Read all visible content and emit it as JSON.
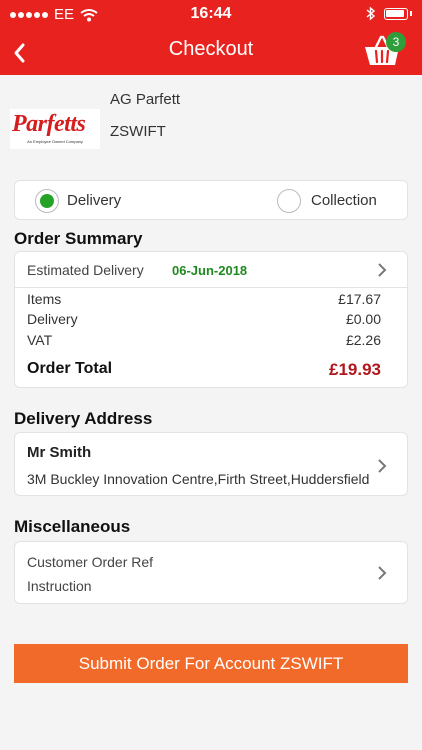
{
  "status_bar": {
    "carrier": "EE",
    "time": "16:44"
  },
  "nav": {
    "title": "Checkout",
    "basket_count": "3",
    "accent_color": "#e8231f"
  },
  "account": {
    "logo_text": "Parfetts",
    "logo_tagline": "An Employee Owned Company",
    "name": "AG Parfett",
    "code": "ZSWIFT"
  },
  "fulfilment": {
    "options": [
      {
        "label": "Delivery",
        "selected": true
      },
      {
        "label": "Collection",
        "selected": false
      }
    ]
  },
  "order_summary": {
    "title": "Order Summary",
    "estimated_label": "Estimated Delivery",
    "estimated_date": "06-Jun-2018",
    "lines": [
      {
        "label": "Items",
        "value": "£17.67"
      },
      {
        "label": "Delivery",
        "value": "£0.00"
      },
      {
        "label": "VAT",
        "value": "£2.26"
      }
    ],
    "total_label": "Order Total",
    "total_value": "£19.93"
  },
  "delivery_address": {
    "title": "Delivery Address",
    "name": "Mr Smith",
    "address": "3M Buckley Innovation Centre,Firth Street,Huddersfield"
  },
  "miscellaneous": {
    "title": "Miscellaneous",
    "ref_label": "Customer Order Ref",
    "instruction_label": "Instruction"
  },
  "submit": {
    "label": "Submit Order For Account ZSWIFT",
    "color": "#f26a2a"
  }
}
